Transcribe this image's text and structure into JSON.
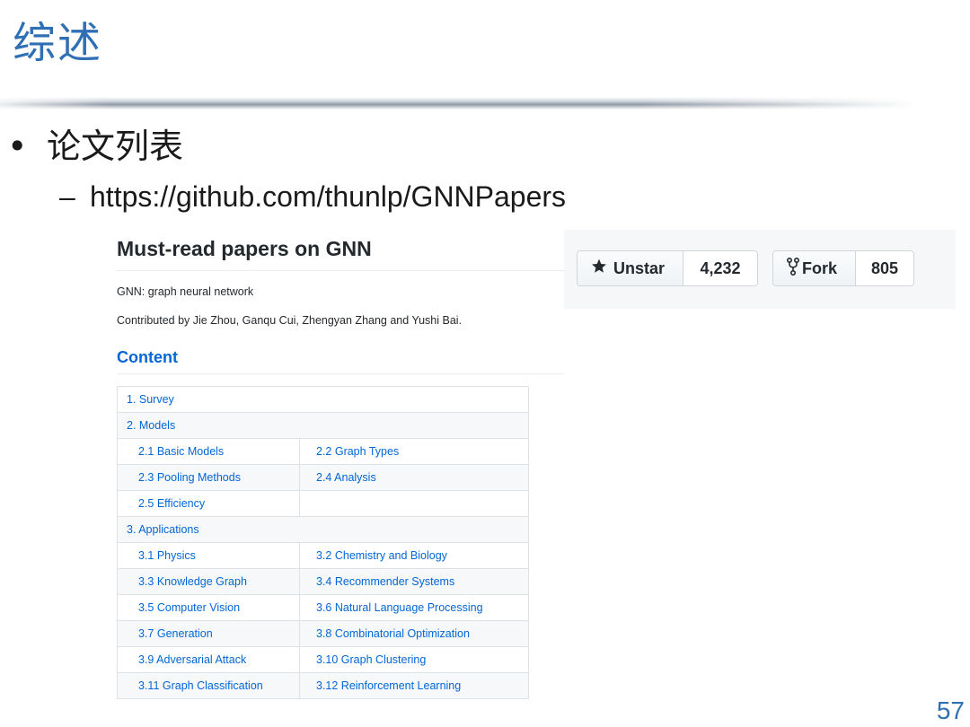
{
  "slide": {
    "title": "综述",
    "bullet_marker": "•",
    "bullet_text": "论文列表",
    "sub_marker": "–",
    "sub_text": "https://github.com/thunlp/GNNPapers",
    "page_number": "57"
  },
  "readme": {
    "heading": "Must-read papers on GNN",
    "line1": "GNN: graph neural network",
    "line2": "Contributed by Jie Zhou, Ganqu Cui, Zhengyan Zhang and Yushi Bai.",
    "content_heading": "Content",
    "toc": [
      {
        "full": "1. Survey"
      },
      {
        "full": "2. Models"
      },
      {
        "left": "2.1 Basic Models",
        "right": "2.2 Graph Types"
      },
      {
        "left": "2.3 Pooling Methods",
        "right": "2.4 Analysis"
      },
      {
        "left": "2.5 Efficiency",
        "right": ""
      },
      {
        "full": "3. Applications"
      },
      {
        "left": "3.1 Physics",
        "right": "3.2 Chemistry and Biology"
      },
      {
        "left": "3.3 Knowledge Graph",
        "right": "3.4 Recommender Systems"
      },
      {
        "left": "3.5 Computer Vision",
        "right": "3.6 Natural Language Processing"
      },
      {
        "left": "3.7 Generation",
        "right": "3.8 Combinatorial Optimization"
      },
      {
        "left": "3.9 Adversarial Attack",
        "right": "3.10 Graph Clustering"
      },
      {
        "left": "3.11 Graph Classification",
        "right": "3.12 Reinforcement Learning"
      }
    ]
  },
  "github_widget": {
    "star_icon": "star-icon",
    "star_label": "Unstar",
    "star_count": "4,232",
    "fork_icon": "fork-icon",
    "fork_label": "Fork",
    "fork_count": "805"
  },
  "colors": {
    "title_blue": "#2f6fb4",
    "link_blue": "#0366d6",
    "text_dark": "#24292e",
    "table_border": "#dfe2e5",
    "row_alt": "#f6f8fa"
  }
}
